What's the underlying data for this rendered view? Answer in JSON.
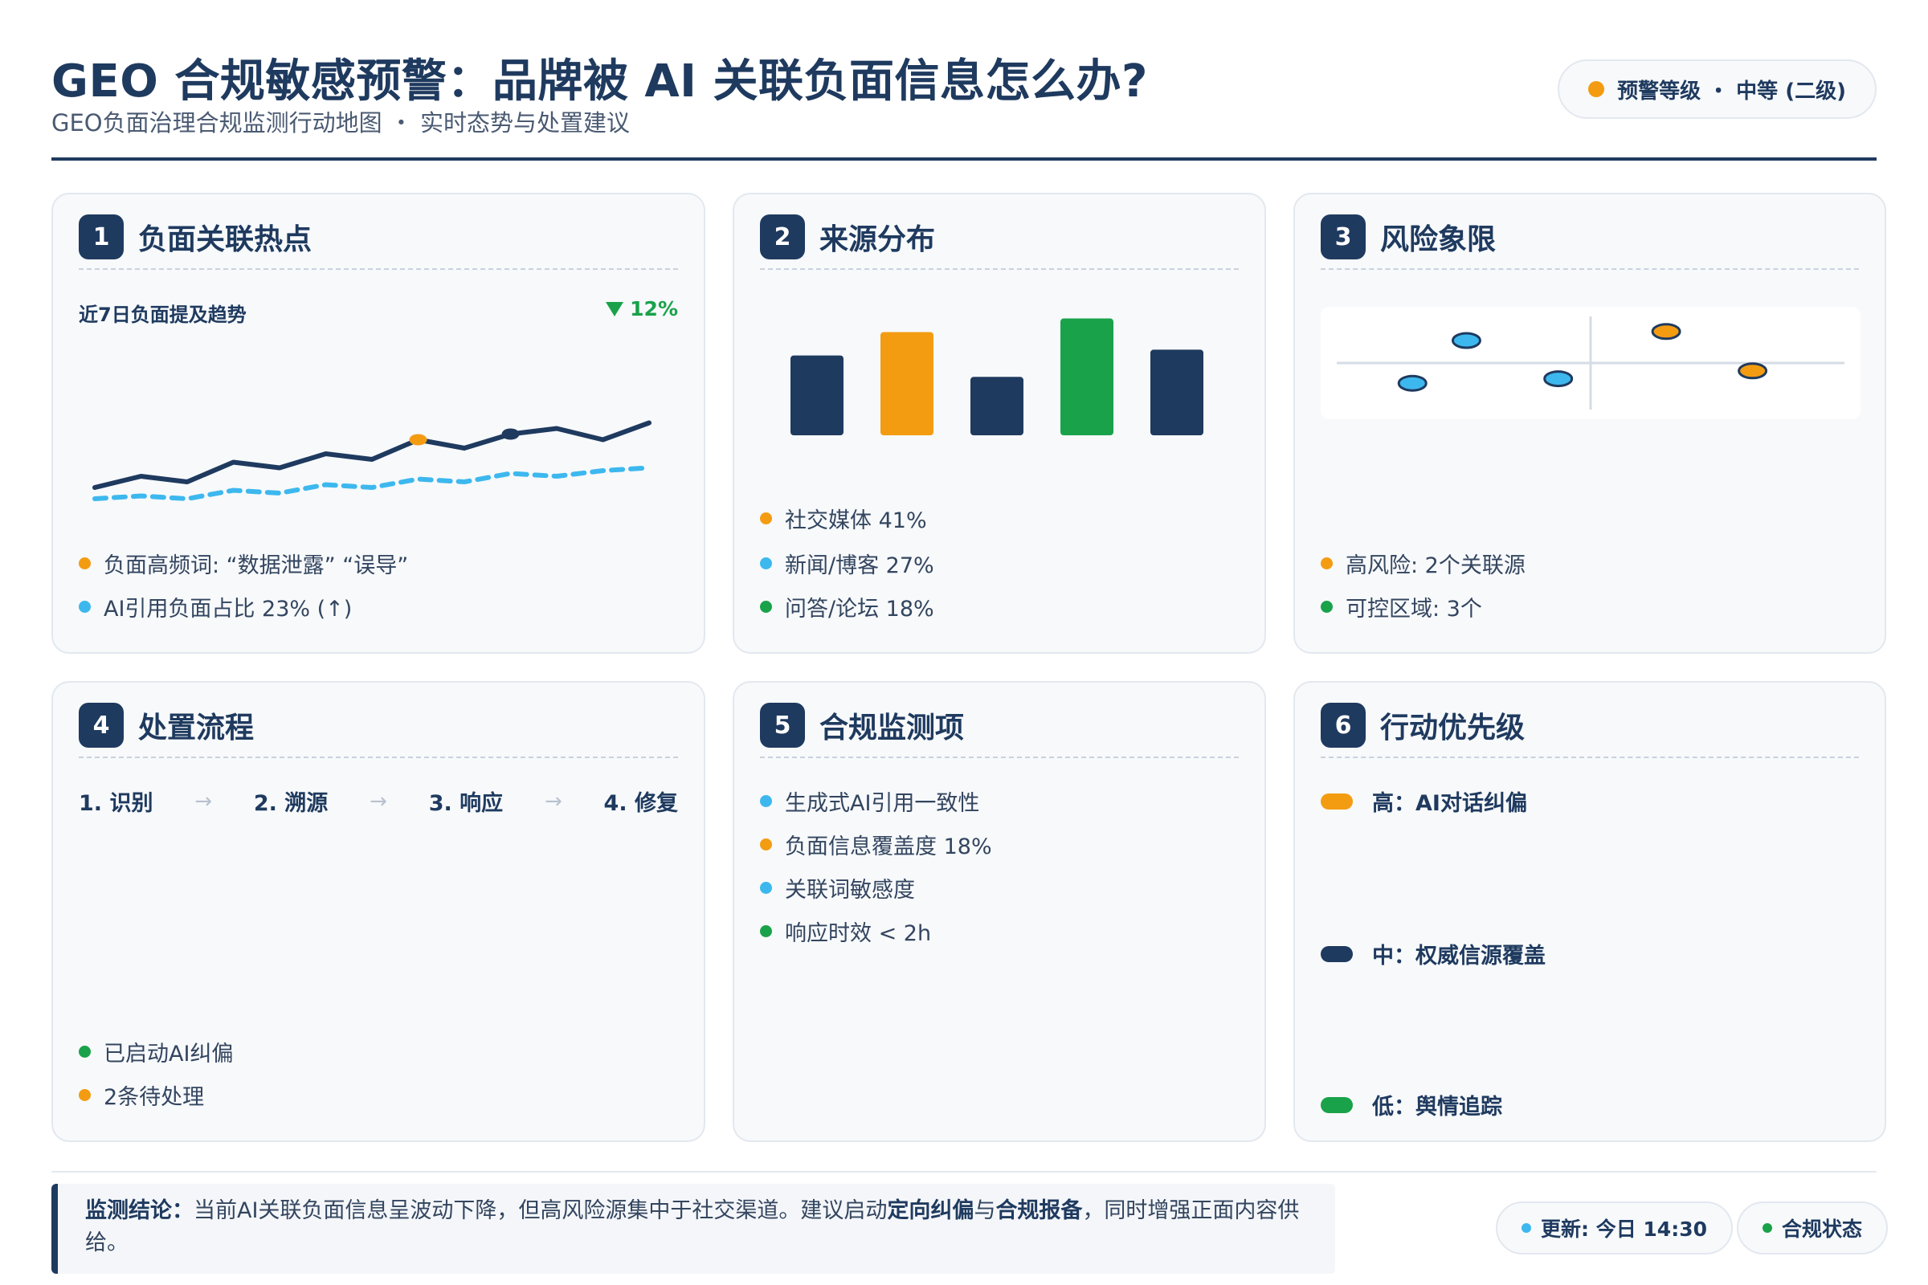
{
  "header": {
    "title": "GEO 合规敏感预警：品牌被 AI 关联负面信息怎么办?",
    "subtitle": "GEO负面治理合规监测行动地图 ・ 实时态势与处置建议",
    "alert_level": "预警等级 ・ 中等 (二级)"
  },
  "cards": {
    "hotspots": {
      "number": "1",
      "title": "负面关联热点",
      "trend_label": "近7日负面提及趋势",
      "trend_change": "12%",
      "bullets": [
        "负面高频词: “数据泄露” “误导”",
        "AI引用负面占比 23% (↑)"
      ]
    },
    "sources": {
      "number": "2",
      "title": "来源分布",
      "bullets": [
        "社交媒体 41%",
        "新闻/博客 27%",
        "问答/论坛 18%"
      ]
    },
    "risk": {
      "number": "3",
      "title": "风险象限",
      "bullets": [
        "高风险: 2个关联源",
        "可控区域: 3个"
      ]
    },
    "process": {
      "number": "4",
      "title": "处置流程",
      "steps": [
        "1. 识别",
        "2. 溯源",
        "3. 响应",
        "4. 修复"
      ],
      "arrow": "→",
      "bullets": [
        "已启动AI纠偏",
        "2条待处理"
      ]
    },
    "monitor": {
      "number": "5",
      "title": "合规监测项",
      "bullets": [
        "生成式AI引用一致性",
        "负面信息覆盖度 18%",
        "关联词敏感度",
        "响应时效 < 2h"
      ]
    },
    "priority": {
      "number": "6",
      "title": "行动优先级",
      "items": [
        "高：AI对话纠偏",
        "中：权威信源覆盖",
        "低：舆情追踪"
      ]
    }
  },
  "footer": {
    "conclusion_label": "监测结论：",
    "conclusion_text_1": "当前AI关联负面信息呈波动下降，但高风险源集中于社交渠道。建议启动",
    "conclusion_bold_1": "定向纠偏",
    "conclusion_text_2": "与",
    "conclusion_bold_2": "合规报备",
    "conclusion_text_3": "，同时增强正面内容供给。",
    "update": "更新: 今日 14:30",
    "status": "合规状态"
  },
  "colors": {
    "navy": "#1f3a5f",
    "orange": "#f39c12",
    "blue": "#3db8ee",
    "green": "#1aa24a"
  },
  "chart_data": [
    {
      "type": "line",
      "title": "近7日负面提及趋势",
      "x": [
        1,
        2,
        3,
        4,
        5,
        6,
        7,
        8,
        9,
        10,
        11,
        12,
        13,
        14,
        15
      ],
      "series": [
        {
          "values": [
            10,
            14,
            12,
            19,
            17,
            22,
            20,
            27,
            24,
            29,
            31,
            27,
            33
          ]
        },
        {
          "values": [
            6,
            7,
            6,
            9,
            8,
            11,
            10,
            13,
            12,
            15,
            14,
            16,
            17
          ]
        }
      ],
      "highlight_points": [
        7,
        9
      ]
    },
    {
      "type": "bar",
      "categories": [
        "1",
        "2",
        "3",
        "4",
        "5"
      ],
      "values": [
        41,
        53,
        30,
        60,
        44
      ],
      "colors": [
        "#1f3a5f",
        "#f39c12",
        "#1f3a5f",
        "#1aa24a",
        "#1f3a5f"
      ]
    },
    {
      "type": "scatter",
      "points": [
        {
          "x": 2.7,
          "y": 7.0,
          "level": "low"
        },
        {
          "x": 1.7,
          "y": 3.2,
          "level": "low"
        },
        {
          "x": 4.4,
          "y": 3.6,
          "level": "low"
        },
        {
          "x": 6.4,
          "y": 7.8,
          "level": "high"
        },
        {
          "x": 8.0,
          "y": 4.3,
          "level": "high"
        }
      ],
      "xlim": [
        0,
        10
      ],
      "ylim": [
        0,
        10
      ],
      "grid": false
    }
  ]
}
